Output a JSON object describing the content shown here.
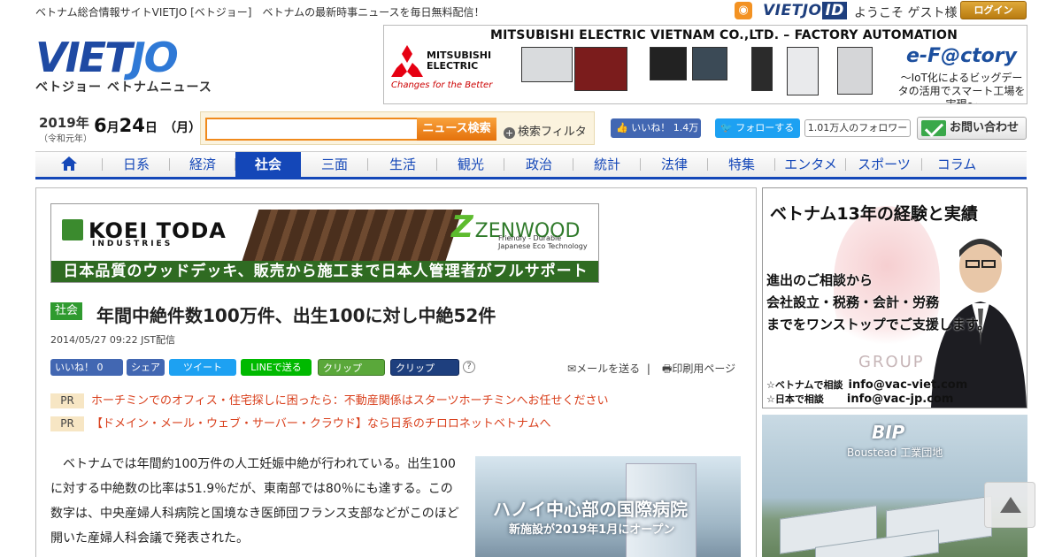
{
  "topbar": {
    "tagline": "ベトナム総合情報サイトVIETJO [ベトジョー]　ベトナムの最新時事ニュースを毎日無料配信！",
    "vietjo_id_a": "VIETJO",
    "vietjo_id_b": "ID",
    "welcome": "ようこそ ゲスト様",
    "login": "ログイン"
  },
  "logo": {
    "mark_a": "VIET",
    "mark_b": "JO",
    "subtitle": "ベトジョー ベトナムニュース"
  },
  "top_ad": {
    "headline": "MITSUBISHI ELECTRIC VIETNAM CO.,LTD. – FACTORY AUTOMATION",
    "brand_line1": "MITSUBISHI",
    "brand_line2": "ELECTRIC",
    "brand_tagline": "Changes for the Better",
    "efactory": "e-F@ctory",
    "efactory_sub": "～IoT化によるビッグデータの活用でスマート工場を実現～"
  },
  "date": {
    "year": "2019年",
    "era": "（令和元年）",
    "month": "6",
    "month_unit": "月",
    "day": "24",
    "day_unit": "日",
    "weekday": "（月）"
  },
  "search": {
    "placeholder": "",
    "button": "ニュース検索",
    "filter": "検索フィルタ"
  },
  "social": {
    "fb_like": "いいね！ 1.4万",
    "tw_follow": "フォローする",
    "tw_followers": "1.01万人のフォロワー",
    "contact": "お問い合わせ"
  },
  "nav": {
    "items": [
      "日系",
      "経済",
      "社会",
      "三面",
      "生活",
      "観光",
      "政治",
      "統計",
      "法律",
      "特集",
      "エンタメ",
      "スポーツ",
      "コラム"
    ],
    "active": "社会"
  },
  "article_ad": {
    "brand": "KOEI TODA",
    "industries": "INDUSTRIES",
    "zenwood": "ZENWOOD",
    "zenwood_sub": "Friendly - Durable Japanese Eco Technology",
    "strip": "日本品質のウッドデッキ、販売から施工まで日本人管理者がフルサポート"
  },
  "article": {
    "category": "社会",
    "title": "年間中絶件数100万件、出生100に対し中絶52件",
    "published": "2014/05/27 09:22 JST配信",
    "body": "　ベトナムでは年間約100万件の人工妊娠中絶が行われている。出生100に対する中絶数の比率は51.9％だが、東南部では80％にも達する。この数字は、中央産婦人科病院と国境なき医師団フランス支部などがこのほど開いた産婦人科会議で発表された。"
  },
  "share": {
    "fb_like": "いいね！ 0",
    "fb_share": "シェア",
    "tweet": "ツイート",
    "line": "LINEで送る",
    "clip": "クリップ",
    "clip_vj": "クリップ",
    "help": "?",
    "mail": "メールを送る",
    "print": "印刷用ページ"
  },
  "pr": [
    {
      "badge": "PR",
      "text": "ホーチミンでのオフィス・住宅探しに困ったら：不動産関係はスターツホーチミンへお任せください"
    },
    {
      "badge": "PR",
      "text": "【ドメイン・メール・ウェブ・サーバー・クラウド】なら日系のチロロネットベトナムへ"
    }
  ],
  "inline_ad": {
    "line1": "ハノイ中心部の国際病院",
    "line2": "新施設が2019年1月にオープン"
  },
  "side_ad1": {
    "title": "ベトナム13年の経験と実績",
    "line1": "進出のご相談から",
    "line2": "会社設立・税務・会計・労務",
    "line3": "までをワンストップでご支援します。",
    "group": "GROUP",
    "contact1_label": "☆ベトナムで相談",
    "contact1": "info@vac-viet.com",
    "contact2_label": "☆日本で相談",
    "contact2": "info@vac-jp.com"
  },
  "side_ad2": {
    "brand": "BIP",
    "name": "Boustead 工業団地"
  },
  "colors": {
    "brand_blue": "#1447b8",
    "accent_orange": "#f08a1c",
    "pr_red": "#d9401d",
    "category_green": "#2f9a2f"
  }
}
